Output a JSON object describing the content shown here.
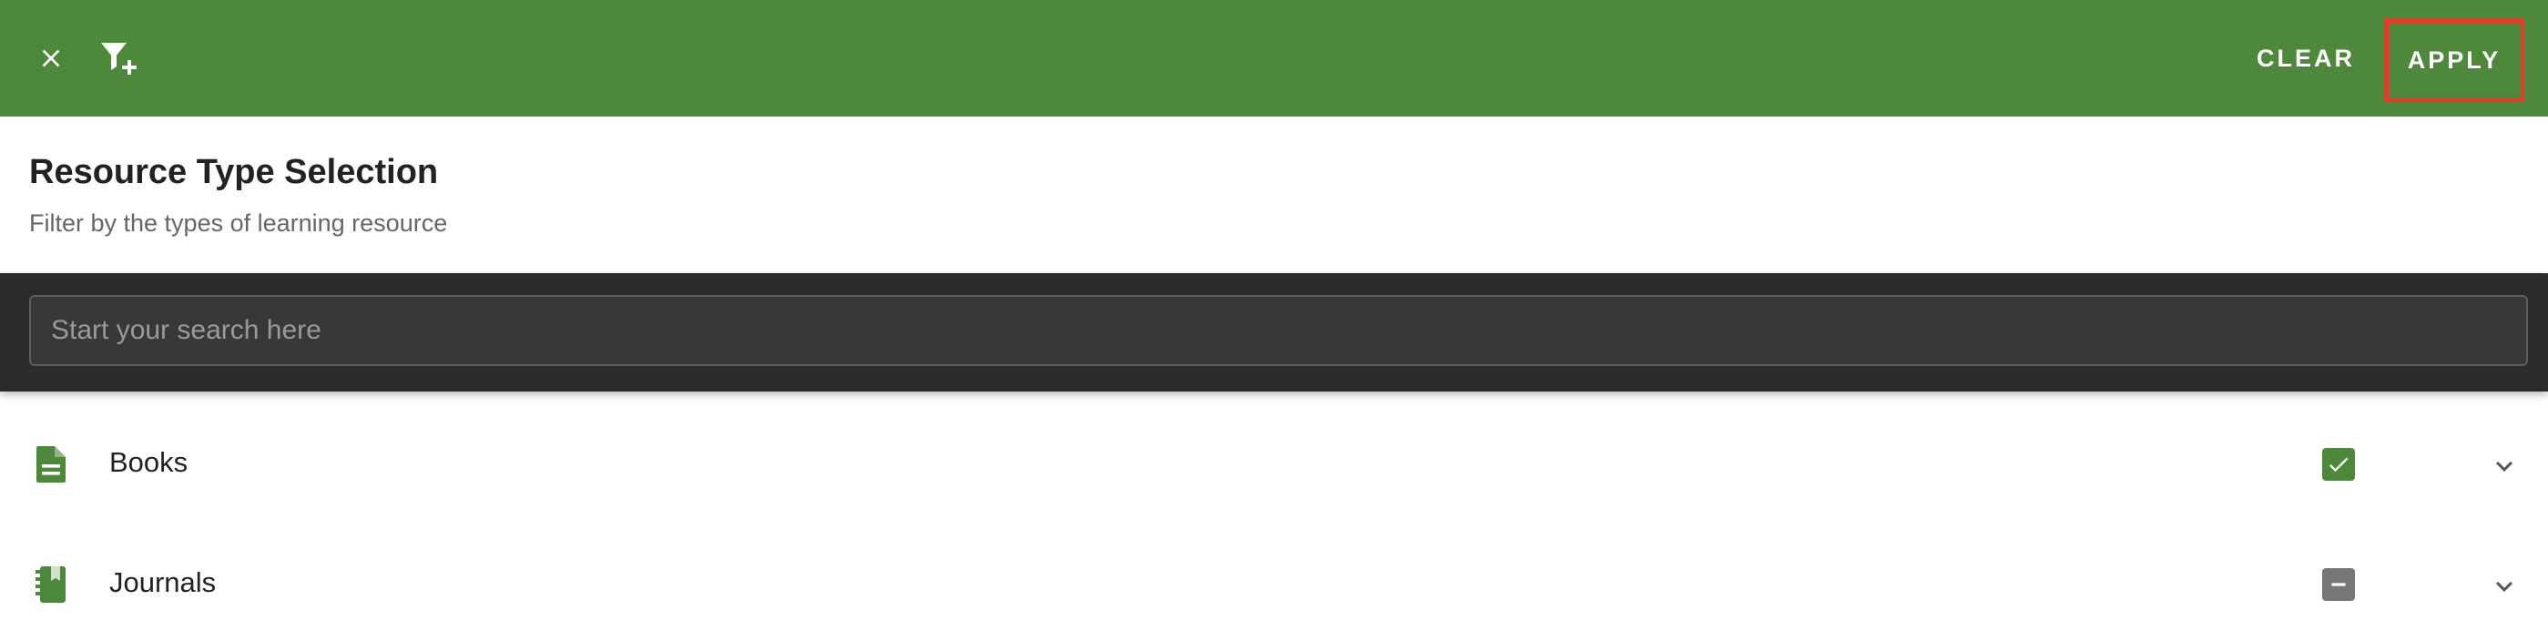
{
  "topbar": {
    "close_icon": "close-icon",
    "filter_icon": "filter-plus-icon",
    "clear_label": "CLEAR",
    "apply_label": "APPLY",
    "background_color": "#4e883b",
    "highlight_color": "#e33c2b"
  },
  "heading": {
    "title": "Resource Type Selection",
    "subtitle": "Filter by the types of learning resource"
  },
  "search": {
    "value": "",
    "placeholder": "Start your search here"
  },
  "items": [
    {
      "label": "Books",
      "icon": "document-icon",
      "checked": true,
      "state": "checked"
    },
    {
      "label": "Journals",
      "icon": "journal-icon",
      "checked": false,
      "state": "indeterminate"
    }
  ]
}
